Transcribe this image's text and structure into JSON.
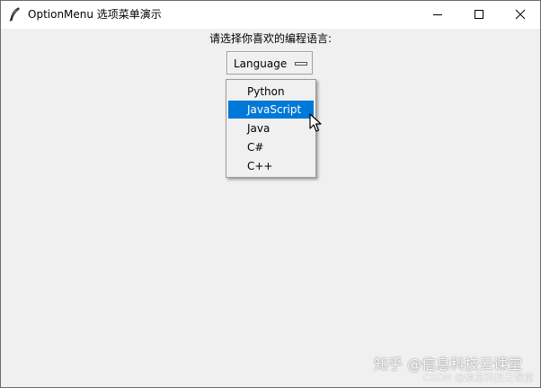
{
  "window": {
    "title": "OptionMenu 选项菜单演示",
    "app_icon": "feather-icon",
    "minimize_icon": "minimize-icon",
    "maximize_icon": "maximize-icon",
    "close_icon": "close-icon"
  },
  "main": {
    "prompt": "请选择你喜欢的编程语言:",
    "option_menu": {
      "selected": "Language",
      "indicator_icon": "option-indicator-icon"
    },
    "dropdown": {
      "items": [
        {
          "label": "Python"
        },
        {
          "label": "JavaScript",
          "highlighted": true
        },
        {
          "label": "Java"
        },
        {
          "label": "C#"
        },
        {
          "label": "C++"
        }
      ]
    }
  },
  "watermark": {
    "main": "知乎 @信息科技云课堂",
    "sub": "CSDN @信息科技云课堂"
  },
  "colors": {
    "highlight": "#0078d7",
    "window_bg": "#f0f0f0",
    "titlebar_bg": "#ffffff"
  }
}
